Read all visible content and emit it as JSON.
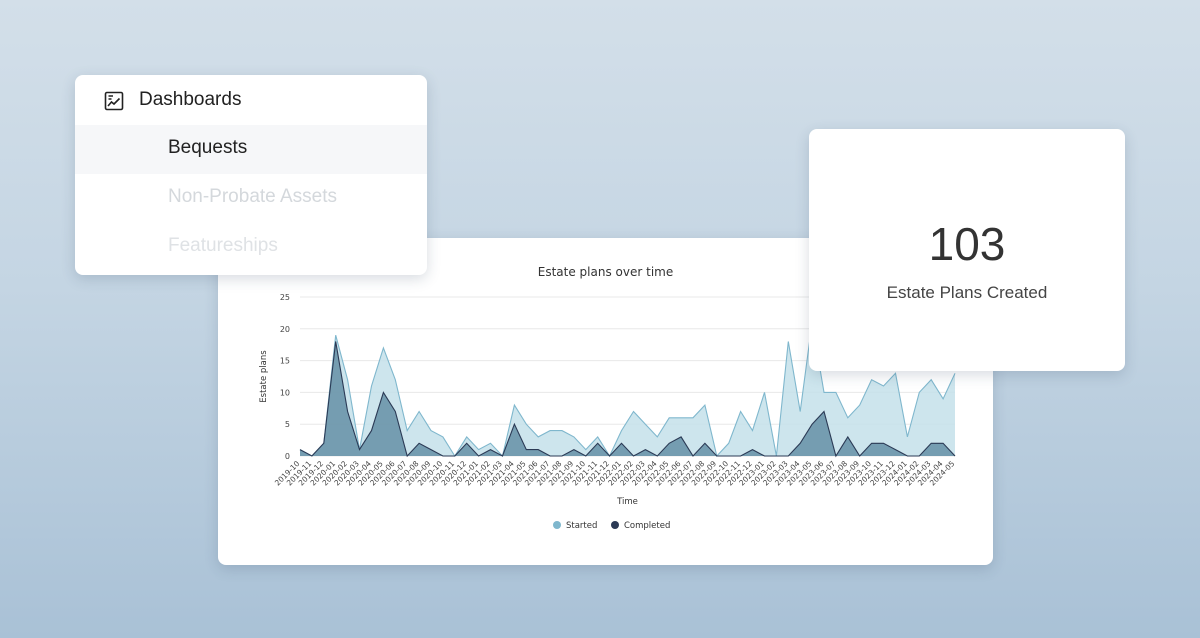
{
  "menu": {
    "title": "Dashboards",
    "icon": "chart-board-icon",
    "items": [
      {
        "label": "Bequests",
        "state": "selected"
      },
      {
        "label": "Non-Probate Assets",
        "state": "faded"
      },
      {
        "label": "Featureships",
        "state": "faded"
      }
    ]
  },
  "stat": {
    "value": "103",
    "label": "Estate Plans Created"
  },
  "chart_data": {
    "type": "area",
    "title": "Estate plans over time",
    "xlabel": "Time",
    "ylabel": "Estate plans",
    "ylim": [
      0,
      25
    ],
    "yticks": [
      0,
      5,
      10,
      15,
      20,
      25
    ],
    "grid": true,
    "legend_position": "bottom",
    "x": [
      "2019-10",
      "2019-11",
      "2019-12",
      "2020-01",
      "2020-02",
      "2020-03",
      "2020-04",
      "2020-05",
      "2020-06",
      "2020-07",
      "2020-08",
      "2020-09",
      "2020-10",
      "2020-11",
      "2020-12",
      "2021-01",
      "2021-02",
      "2021-03",
      "2021-04",
      "2021-05",
      "2021-06",
      "2021-07",
      "2021-08",
      "2021-09",
      "2021-10",
      "2021-11",
      "2021-12",
      "2022-01",
      "2022-02",
      "2022-03",
      "2022-04",
      "2022-05",
      "2022-06",
      "2022-07",
      "2022-08",
      "2022-09",
      "2022-10",
      "2022-11",
      "2022-12",
      "2023-01",
      "2023-02",
      "2023-03",
      "2023-04",
      "2023-05",
      "2023-06",
      "2023-07",
      "2023-08",
      "2023-09",
      "2023-10",
      "2023-11",
      "2023-12",
      "2024-01",
      "2024-02",
      "2024-03",
      "2024-04",
      "2024-05"
    ],
    "series": [
      {
        "name": "Started",
        "color": "#7fb7cd",
        "fill": "#c4e1ea",
        "values": [
          1,
          0,
          2,
          19,
          12,
          1,
          11,
          17,
          12,
          4,
          7,
          4,
          3,
          0,
          3,
          1,
          2,
          0,
          8,
          5,
          3,
          4,
          4,
          3,
          1,
          3,
          0,
          4,
          7,
          5,
          3,
          6,
          6,
          6,
          8,
          0,
          2,
          7,
          4,
          10,
          0,
          18,
          7,
          21,
          10,
          10,
          6,
          8,
          12,
          11,
          13,
          3,
          10,
          12,
          9,
          13
        ]
      },
      {
        "name": "Completed",
        "color": "#2b3a55",
        "fill": "#6b95aa",
        "values": [
          1,
          0,
          2,
          18,
          7,
          1,
          4,
          10,
          7,
          0,
          2,
          1,
          0,
          0,
          2,
          0,
          1,
          0,
          5,
          1,
          1,
          0,
          0,
          1,
          0,
          2,
          0,
          2,
          0,
          1,
          0,
          2,
          3,
          0,
          2,
          0,
          0,
          0,
          1,
          0,
          0,
          0,
          2,
          5,
          7,
          0,
          3,
          0,
          2,
          2,
          1,
          0,
          0,
          2,
          2,
          0
        ]
      }
    ]
  }
}
